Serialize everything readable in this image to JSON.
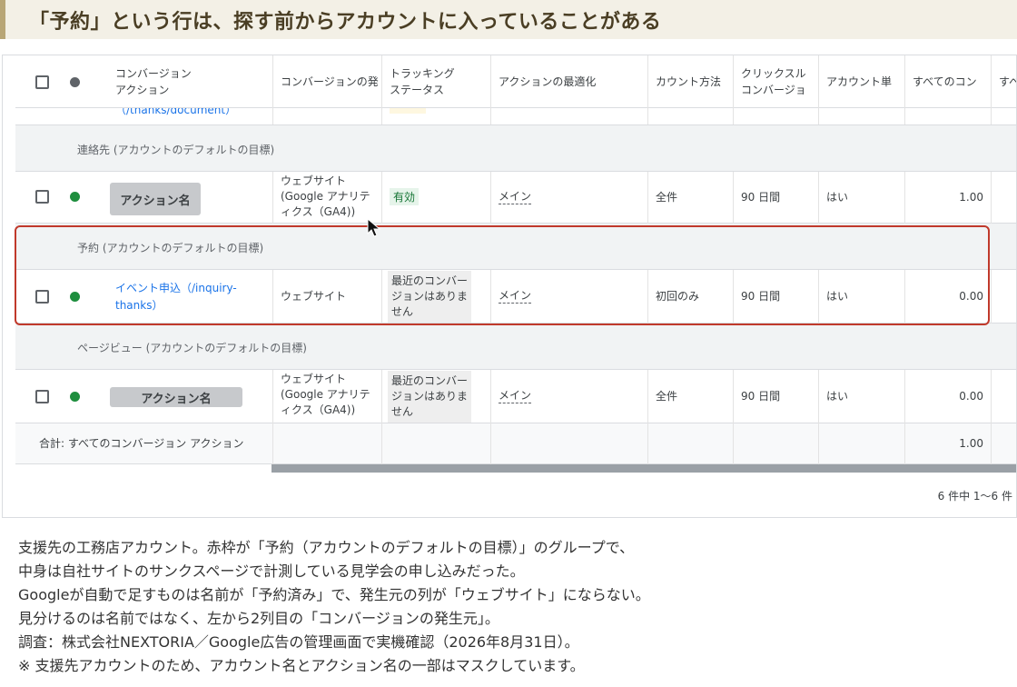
{
  "heading": "「予約」という行は、探す前からアカウントに入っていることがある",
  "table": {
    "columns": {
      "action": "コンバージョン\nアクション",
      "source": "コンバージョンの発",
      "tracking": "トラッキング\nステータス",
      "optimization": "アクションの最適化",
      "count": "カウント方法",
      "window": "クリックスル\nコンバージョ",
      "account": "アカウント単",
      "all": "すべてのコン",
      "extra": "すべ"
    },
    "truncated_row_link": "（/thanks/document）",
    "groups": [
      {
        "label": "連絡先 (アカウントのデフォルトの目標)",
        "row": {
          "action": "アクション名",
          "source": "ウェブサイト\n(Google アナリテ\nィクス（GA4))",
          "tracking": "有効",
          "optimization": "メイン",
          "count": "全件",
          "window": "90 日間",
          "account": "はい",
          "value": "1.00"
        }
      },
      {
        "label": "予約 (アカウントのデフォルトの目標)",
        "row": {
          "action": "イベント申込（/inquiry-\nthanks）",
          "source": "ウェブサイト",
          "tracking": "最近のコンバー\nジョンはありま\nせん",
          "optimization": "メイン",
          "count": "初回のみ",
          "window": "90 日間",
          "account": "はい",
          "value": "0.00"
        }
      },
      {
        "label": "ページビュー (アカウントのデフォルトの目標)",
        "row": {
          "action": "アクション名",
          "source": "ウェブサイト\n(Google アナリテ\nィクス（GA4))",
          "tracking": "最近のコンバー\nジョンはありま\nせん",
          "optimization": "メイン",
          "count": "全件",
          "window": "90 日間",
          "account": "はい",
          "value": "0.00"
        }
      }
    ],
    "total_label": "合計: すべてのコンバージョン アクション",
    "total_value": "1.00",
    "pagination": "6 件中 1～6 件"
  },
  "caption": [
    "支援先の工務店アカウント。赤枠が「予約（アカウントのデフォルトの目標）」のグループで、",
    "中身は自社サイトのサンクスページで計測している見学会の申し込みだった。",
    "Googleが自動で足すものは名前が「予約済み」で、発生元の列が「ウェブサイト」にならない。",
    "見分けるのは名前ではなく、左から2列目の「コンバージョンの発生元」。",
    "調査：株式会社NEXTORIA／Google広告の管理画面で実機確認（2026年8月31日）。",
    "※ 支援先アカウントのため、アカウント名とアクション名の一部はマスクしています。"
  ]
}
